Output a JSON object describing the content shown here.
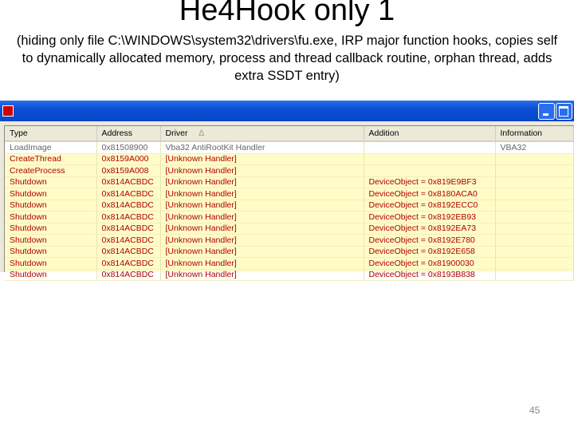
{
  "slide": {
    "title": "He4Hook only 1",
    "subtitle": "(hiding only file C:\\WINDOWS\\system32\\drivers\\fu.exe, IRP major function hooks, copies self to dynamically allocated memory, process and thread callback routine, orphan thread, adds extra SSDT entry)",
    "page_number": "45"
  },
  "window": {
    "columns": [
      "Type",
      "Address",
      "Driver",
      "Addition",
      "Information"
    ],
    "sort_indicator": "∆",
    "rows": [
      {
        "type": "LoadImage",
        "address": "0x81508900",
        "driver": "Vba32 AntiRootKit Handler",
        "addition": "",
        "information": "VBA32",
        "state": "normal"
      },
      {
        "type": "CreateThread",
        "address": "0x8159A000",
        "driver": "[Unknown Handler]",
        "addition": "",
        "information": "",
        "state": "suspicious"
      },
      {
        "type": "CreateProcess",
        "address": "0x8159A008",
        "driver": "[Unknown Handler]",
        "addition": "",
        "information": "",
        "state": "suspicious"
      },
      {
        "type": "Shutdown",
        "address": "0x814ACBDC",
        "driver": "[Unknown Handler]",
        "addition": "DeviceObject = 0x819E9BF3",
        "information": "",
        "state": "suspicious"
      },
      {
        "type": "Shutdown",
        "address": "0x814ACBDC",
        "driver": "[Unknown Handler]",
        "addition": "DeviceObject = 0x8180ACA0",
        "information": "",
        "state": "suspicious"
      },
      {
        "type": "Shutdown",
        "address": "0x814ACBDC",
        "driver": "[Unknown Handler]",
        "addition": "DeviceObject = 0x8192ECC0",
        "information": "",
        "state": "suspicious"
      },
      {
        "type": "Shutdown",
        "address": "0x814ACBDC",
        "driver": "[Unknown Handler]",
        "addition": "DeviceObject = 0x8192EB93",
        "information": "",
        "state": "suspicious"
      },
      {
        "type": "Shutdown",
        "address": "0x814ACBDC",
        "driver": "[Unknown Handler]",
        "addition": "DeviceObject = 0x8192EA73",
        "information": "",
        "state": "suspicious"
      },
      {
        "type": "Shutdown",
        "address": "0x814ACBDC",
        "driver": "[Unknown Handler]",
        "addition": "DeviceObject = 0x8192E780",
        "information": "",
        "state": "suspicious"
      },
      {
        "type": "Shutdown",
        "address": "0x814ACBDC",
        "driver": "[Unknown Handler]",
        "addition": "DeviceObject = 0x8192E658",
        "information": "",
        "state": "suspicious"
      },
      {
        "type": "Shutdown",
        "address": "0x814ACBDC",
        "driver": "[Unknown Handler]",
        "addition": "DeviceObject = 0x81900030",
        "information": "",
        "state": "suspicious"
      },
      {
        "type": "Shutdown",
        "address": "0x814ACBDC",
        "driver": "[Unknown Handler]",
        "addition": "DeviceObject = 0x8193B838",
        "information": "",
        "state": "suspicious"
      }
    ]
  },
  "colors": {
    "titlebar": "#0a4fd6",
    "row_highlight": "#fffcc8",
    "suspicious_text": "#b00000"
  }
}
